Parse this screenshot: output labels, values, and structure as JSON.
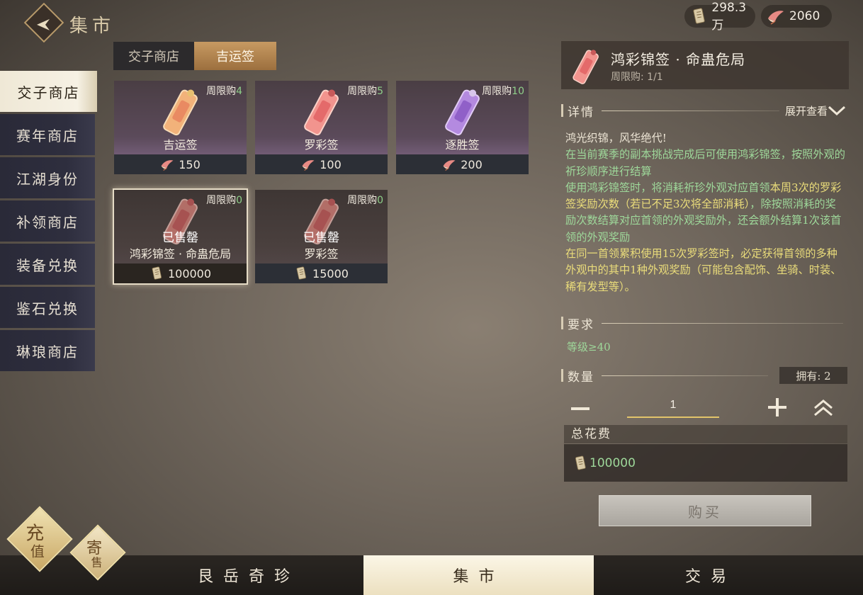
{
  "header": {
    "title": "集市",
    "currencies": [
      {
        "name": "jiaozi",
        "value": "298.3万"
      },
      {
        "name": "feather",
        "value": "2060"
      }
    ]
  },
  "sidebar": {
    "items": [
      {
        "label": "交子商店",
        "active": true
      },
      {
        "label": "赛年商店",
        "active": false
      },
      {
        "label": "江湖身份",
        "active": false
      },
      {
        "label": "补领商店",
        "active": false
      },
      {
        "label": "装备兑换",
        "active": false
      },
      {
        "label": "鉴石兑换",
        "active": false
      },
      {
        "label": "琳琅商店",
        "active": false
      }
    ]
  },
  "shop_tabs": [
    {
      "label": "交子商店",
      "active": false
    },
    {
      "label": "吉运签",
      "active": true
    }
  ],
  "items": [
    {
      "name": "吉运签",
      "limit_label": "周限购",
      "limit_num": "4",
      "price": "150",
      "currency": "feather",
      "sold": ""
    },
    {
      "name": "罗彩签",
      "limit_label": "周限购",
      "limit_num": "5",
      "price": "100",
      "currency": "feather",
      "sold": ""
    },
    {
      "name": "逐胜签",
      "limit_label": "周限购",
      "limit_num": "10",
      "price": "200",
      "currency": "feather",
      "sold": ""
    },
    {
      "name": "鸿彩锦签 · 命蛊危局",
      "limit_label": "周限购",
      "limit_num": "0",
      "price": "100000",
      "currency": "jiaozi",
      "sold": "已售罄"
    },
    {
      "name": "罗彩签",
      "limit_label": "周限购",
      "limit_num": "0",
      "price": "15000",
      "currency": "jiaozi",
      "sold": "已售罄"
    }
  ],
  "detail": {
    "title": "鸿彩锦签 · 命蛊危局",
    "limit": "周限购: 1/1",
    "section_detail": "详情",
    "expand": "展开查看",
    "desc_line1": "鸿光织锦，风华绝代!",
    "desc_green1": "在当前赛季的副本挑战完成后可使用鸿彩锦签，按照外观的祈珍顺序进行结算",
    "desc_green2a": "使用鸿彩锦签时，将消耗祈珍外观对应首领",
    "desc_yellow1": "本周3次的罗彩签奖励次数（若已不足3次将全部消耗）",
    "desc_green2b": "，除按照消耗的奖励次数结算对应首领的外观奖励外，还会额外结算1次该首领的外观奖励",
    "desc_yellow2": "在同一首领累积使用15次罗彩签时，必定获得首领的多种外观中的其中1种外观奖励（可能包含配饰、坐骑、时装、稀有发型等）。",
    "section_req": "要求",
    "requirement": "等级≥40",
    "section_qty": "数量",
    "owned": "拥有: 2",
    "quantity": "1",
    "total_label": "总花费",
    "total_value": "100000",
    "buy": "购买"
  },
  "bottom_nav": [
    {
      "label": "艮岳奇珍",
      "active": false
    },
    {
      "label": "集市",
      "active": true
    },
    {
      "label": "交易",
      "active": false
    }
  ],
  "corner": {
    "recharge_a": "充",
    "recharge_b": "值",
    "consign_a": "寄",
    "consign_b": "售"
  }
}
